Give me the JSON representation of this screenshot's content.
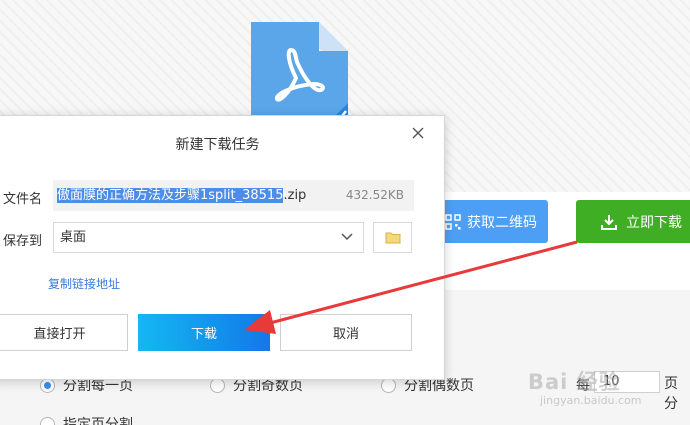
{
  "background": {
    "qr_button_label": "获取二维码",
    "download_now_label": "立即下载",
    "options": {
      "split_each_page": "分割每一页",
      "split_odd_pages": "分割奇数页",
      "split_even_pages": "分割偶数页",
      "per_prefix": "每",
      "page_count": "10",
      "page_unit": "页分",
      "split_specified": "指定页分割"
    },
    "watermark": "Bai 经验",
    "watermark_sub": "jingyan.baidu.com"
  },
  "dialog": {
    "title": "新建下载任务",
    "filename_label": "文件名",
    "filename_selected": "傲面膜的正确方法及步骤1split_38515",
    "filename_ext": ".zip",
    "file_size": "432.52KB",
    "saveto_label": "保存到",
    "saveto_value": "桌面",
    "copy_link_label": "复制链接地址",
    "open_direct_label": "直接打开",
    "download_label": "下载",
    "cancel_label": "取消"
  },
  "colors": {
    "accent_blue": "#4d9ff5",
    "accent_green": "#3fae24",
    "annotation_red": "#e8393b"
  }
}
